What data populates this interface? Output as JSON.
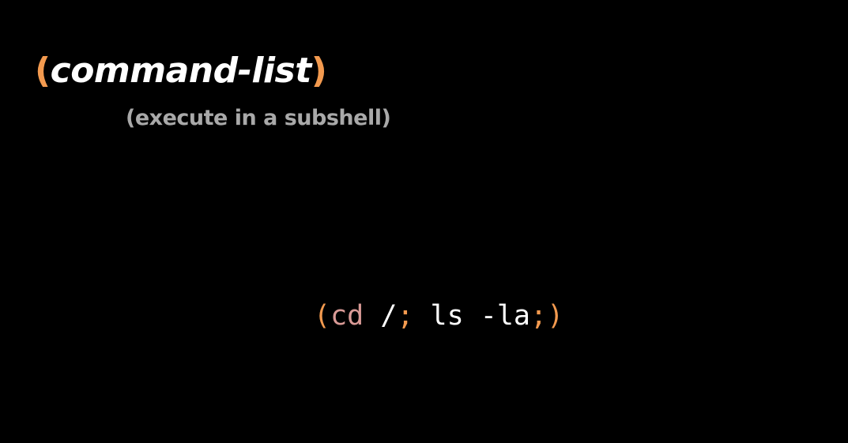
{
  "colors": {
    "background": "#000000",
    "accent_orange": "#f39a4f",
    "title_white": "#ffffff",
    "subtitle_gray": "#a9a9a9",
    "command_pink": "#d99a96"
  },
  "title": {
    "open_paren": "(",
    "text": "command-list",
    "close_paren": ")"
  },
  "subtitle": "(execute in a subshell)",
  "code": {
    "open_paren": "(",
    "cmd1": "cd",
    "space1": " ",
    "arg1": "/",
    "semi1": ";",
    "rest": " ls -la",
    "semi2": ";",
    "close_paren": ")"
  }
}
